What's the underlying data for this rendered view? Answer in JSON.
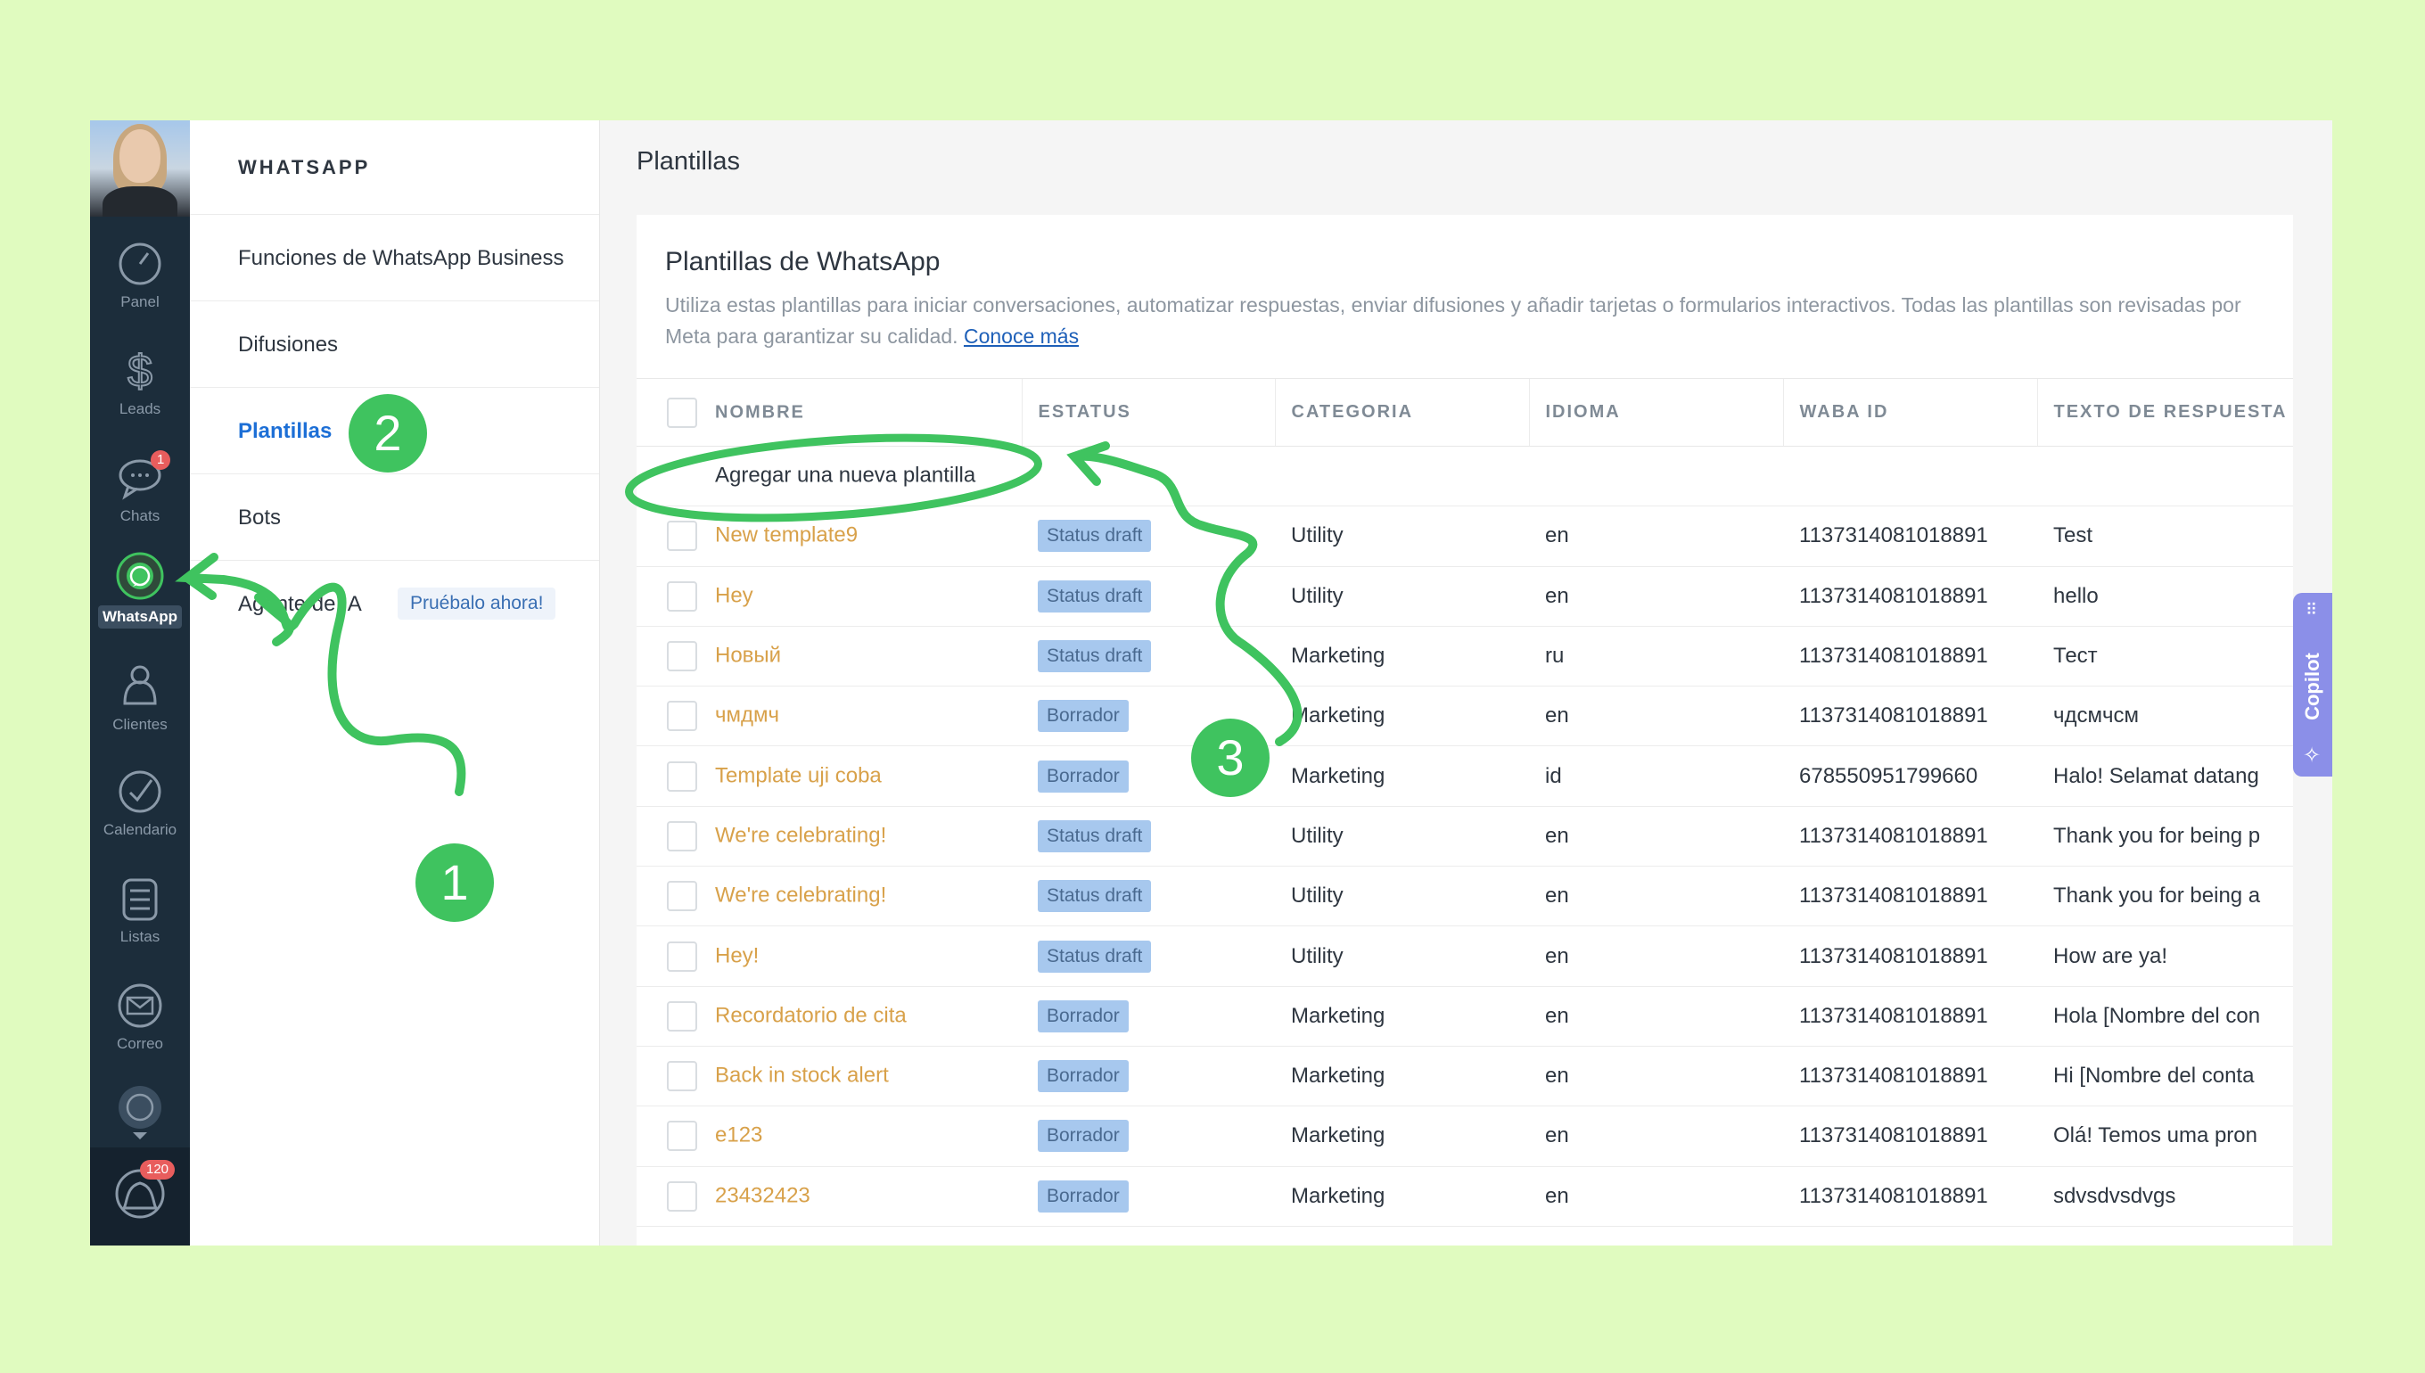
{
  "nav": {
    "items": [
      {
        "label": "Panel",
        "icon": "dashboard-icon"
      },
      {
        "label": "Leads",
        "icon": "dollar-icon"
      },
      {
        "label": "Chats",
        "icon": "chat-icon",
        "badge": "1"
      },
      {
        "label": "WhatsApp",
        "icon": "whatsapp-icon",
        "active": true
      },
      {
        "label": "Clientes",
        "icon": "clients-icon"
      },
      {
        "label": "Calendario",
        "icon": "calendar-check-icon"
      },
      {
        "label": "Listas",
        "icon": "list-icon"
      },
      {
        "label": "Correo",
        "icon": "mail-icon"
      }
    ],
    "notifications_badge": "120"
  },
  "sidebar": {
    "title": "WHATSAPP",
    "items": [
      {
        "label": "Funciones de WhatsApp Business"
      },
      {
        "label": "Difusiones"
      },
      {
        "label": "Plantillas",
        "active": true
      },
      {
        "label": "Bots"
      },
      {
        "label": "Agente de IA",
        "tag": "Pruébalo ahora!"
      }
    ]
  },
  "main": {
    "title": "Plantillas",
    "card_title": "Plantillas de WhatsApp",
    "description": "Utiliza estas plantillas para iniciar conversaciones, automatizar respuestas, enviar difusiones y añadir tarjetas o formularios interactivos. Todas las plantillas son revisadas por Meta para garantizar su calidad.",
    "learn_more": "Conoce más"
  },
  "table": {
    "headers": [
      "NOMBRE",
      "ESTATUS",
      "CATEGORIA",
      "IDIOMA",
      "WABA ID",
      "TEXTO DE RESPUESTA"
    ],
    "add_label": "Agregar una nueva plantilla",
    "rows": [
      {
        "name": "New template9",
        "status": "Status draft",
        "category": "Utility",
        "lang": "en",
        "waba": "1137314081018891",
        "text": "Test"
      },
      {
        "name": "Hey",
        "status": "Status draft",
        "category": "Utility",
        "lang": "en",
        "waba": "1137314081018891",
        "text": "hello"
      },
      {
        "name": "Новый",
        "status": "Status draft",
        "category": "Marketing",
        "lang": "ru",
        "waba": "1137314081018891",
        "text": "Тест"
      },
      {
        "name": "чмдмч",
        "status": "Borrador",
        "category": "Marketing",
        "lang": "en",
        "waba": "1137314081018891",
        "text": "чдсмчсм"
      },
      {
        "name": "Template uji coba",
        "status": "Borrador",
        "category": "Marketing",
        "lang": "id",
        "waba": "678550951799660",
        "text": "Halo! Selamat datang"
      },
      {
        "name": "We're celebrating!",
        "status": "Status draft",
        "category": "Utility",
        "lang": "en",
        "waba": "1137314081018891",
        "text": "Thank you for being p"
      },
      {
        "name": "We're celebrating!",
        "status": "Status draft",
        "category": "Utility",
        "lang": "en",
        "waba": "1137314081018891",
        "text": "Thank you for being a"
      },
      {
        "name": "Hey!",
        "status": "Status draft",
        "category": "Utility",
        "lang": "en",
        "waba": "1137314081018891",
        "text": "How are ya!"
      },
      {
        "name": "Recordatorio de cita",
        "status": "Borrador",
        "category": "Marketing",
        "lang": "en",
        "waba": "1137314081018891",
        "text": "Hola [Nombre del con"
      },
      {
        "name": "Back in stock alert",
        "status": "Borrador",
        "category": "Marketing",
        "lang": "en",
        "waba": "1137314081018891",
        "text": "Hi [Nombre del conta"
      },
      {
        "name": "e123",
        "status": "Borrador",
        "category": "Marketing",
        "lang": "en",
        "waba": "1137314081018891",
        "text": "Olá! Temos uma pron"
      },
      {
        "name": "23432423",
        "status": "Borrador",
        "category": "Marketing",
        "lang": "en",
        "waba": "1137314081018891",
        "text": "sdvsdvsdvgs"
      }
    ]
  },
  "copilot": {
    "label": "Copilot"
  },
  "annotations": [
    "1",
    "2",
    "3"
  ],
  "colors": {
    "accent_green": "#3fc35f",
    "nav_bg": "#1c2d3b",
    "name_link": "#d8a14a",
    "status_badge": "#a7c8ee"
  }
}
